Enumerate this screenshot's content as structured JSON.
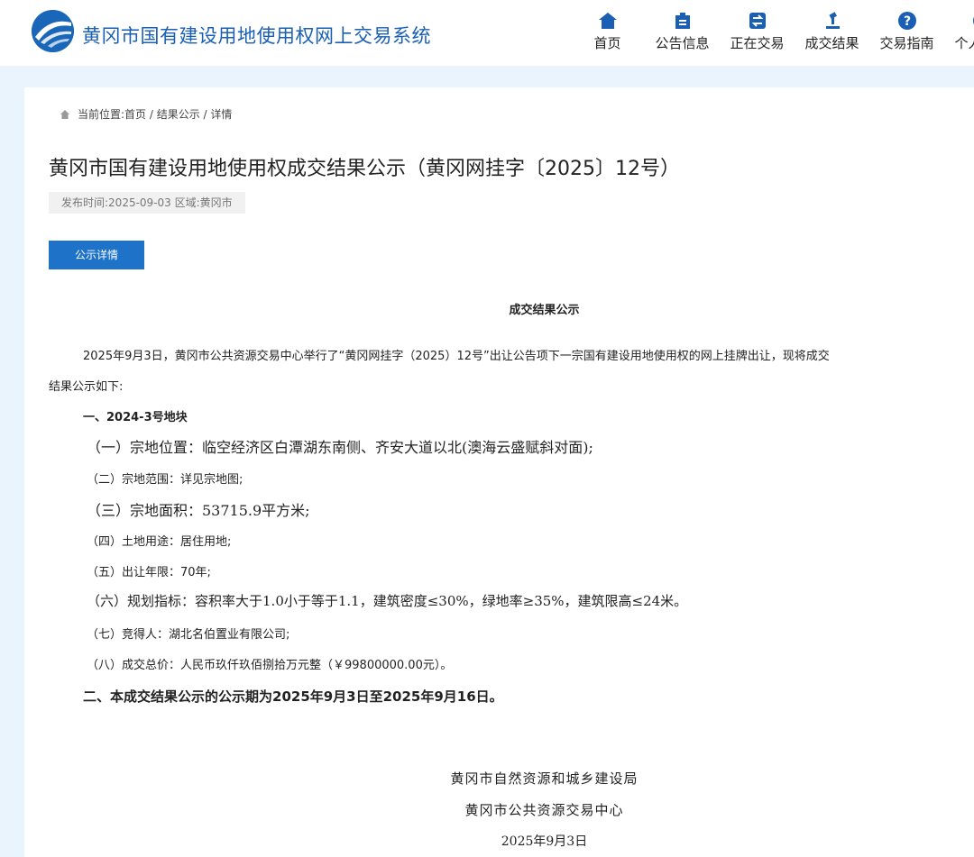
{
  "header": {
    "site_title": "黄冈市国有建设用地使用权网上交易系统",
    "nav": [
      {
        "label": "首页",
        "icon": "home-icon"
      },
      {
        "label": "公告信息",
        "icon": "announcement-icon"
      },
      {
        "label": "正在交易",
        "icon": "exchange-icon"
      },
      {
        "label": "成交结果",
        "icon": "gavel-icon"
      },
      {
        "label": "交易指南",
        "icon": "help-icon"
      },
      {
        "label": "个人中心",
        "icon": "user-icon"
      }
    ]
  },
  "breadcrumb": "当前位置:首页 / 结果公示 / 详情",
  "page_title": "黄冈市国有建设用地使用权成交结果公示（黄冈网挂字〔2025〕12号）",
  "meta": "发布时间:2025-09-03  区域:黄冈市",
  "tab_label": "公示详情",
  "doc": {
    "heading": "成交结果公示",
    "intro_1": "2025年9月3日，黄冈市公共资源交易中心举行了“黄冈网挂字（2025）12号”出让公告项下一宗国有建设用地使用权的网上挂牌出让，现将成交",
    "intro_2": "结果公示如下:",
    "section_1": "一、2024-3号地块",
    "items": [
      "（一）宗地位置：临空经济区白潭湖东南侧、齐安大道以北(澳海云盛赋斜对面);",
      "（二）宗地范围：详见宗地图;",
      "（三）宗地面积：53715.9平方米;",
      "（四）土地用途：居住用地;",
      "（五）出让年限：70年;",
      "（六）规划指标：容积率大于1.0小于等于1.1，建筑密度≤30%，绿地率≥35%，建筑限高≤24米。",
      "（七）竞得人：湖北名伯置业有限公司;",
      "（八）成交总价：人民币玖仟玖佰捌拾万元整（￥99800000.00元）。"
    ],
    "section_2": "二、本成交结果公示的公示期为2025年9月3日至2025年9月16日。",
    "sign_1": "黄冈市自然资源和城乡建设局",
    "sign_2": "黄冈市公共资源交易中心",
    "sign_date": "2025年9月3日"
  },
  "colors": {
    "brand": "#1a5fb4",
    "button": "#1e72c8",
    "page_bg": "#eaf4fc"
  }
}
